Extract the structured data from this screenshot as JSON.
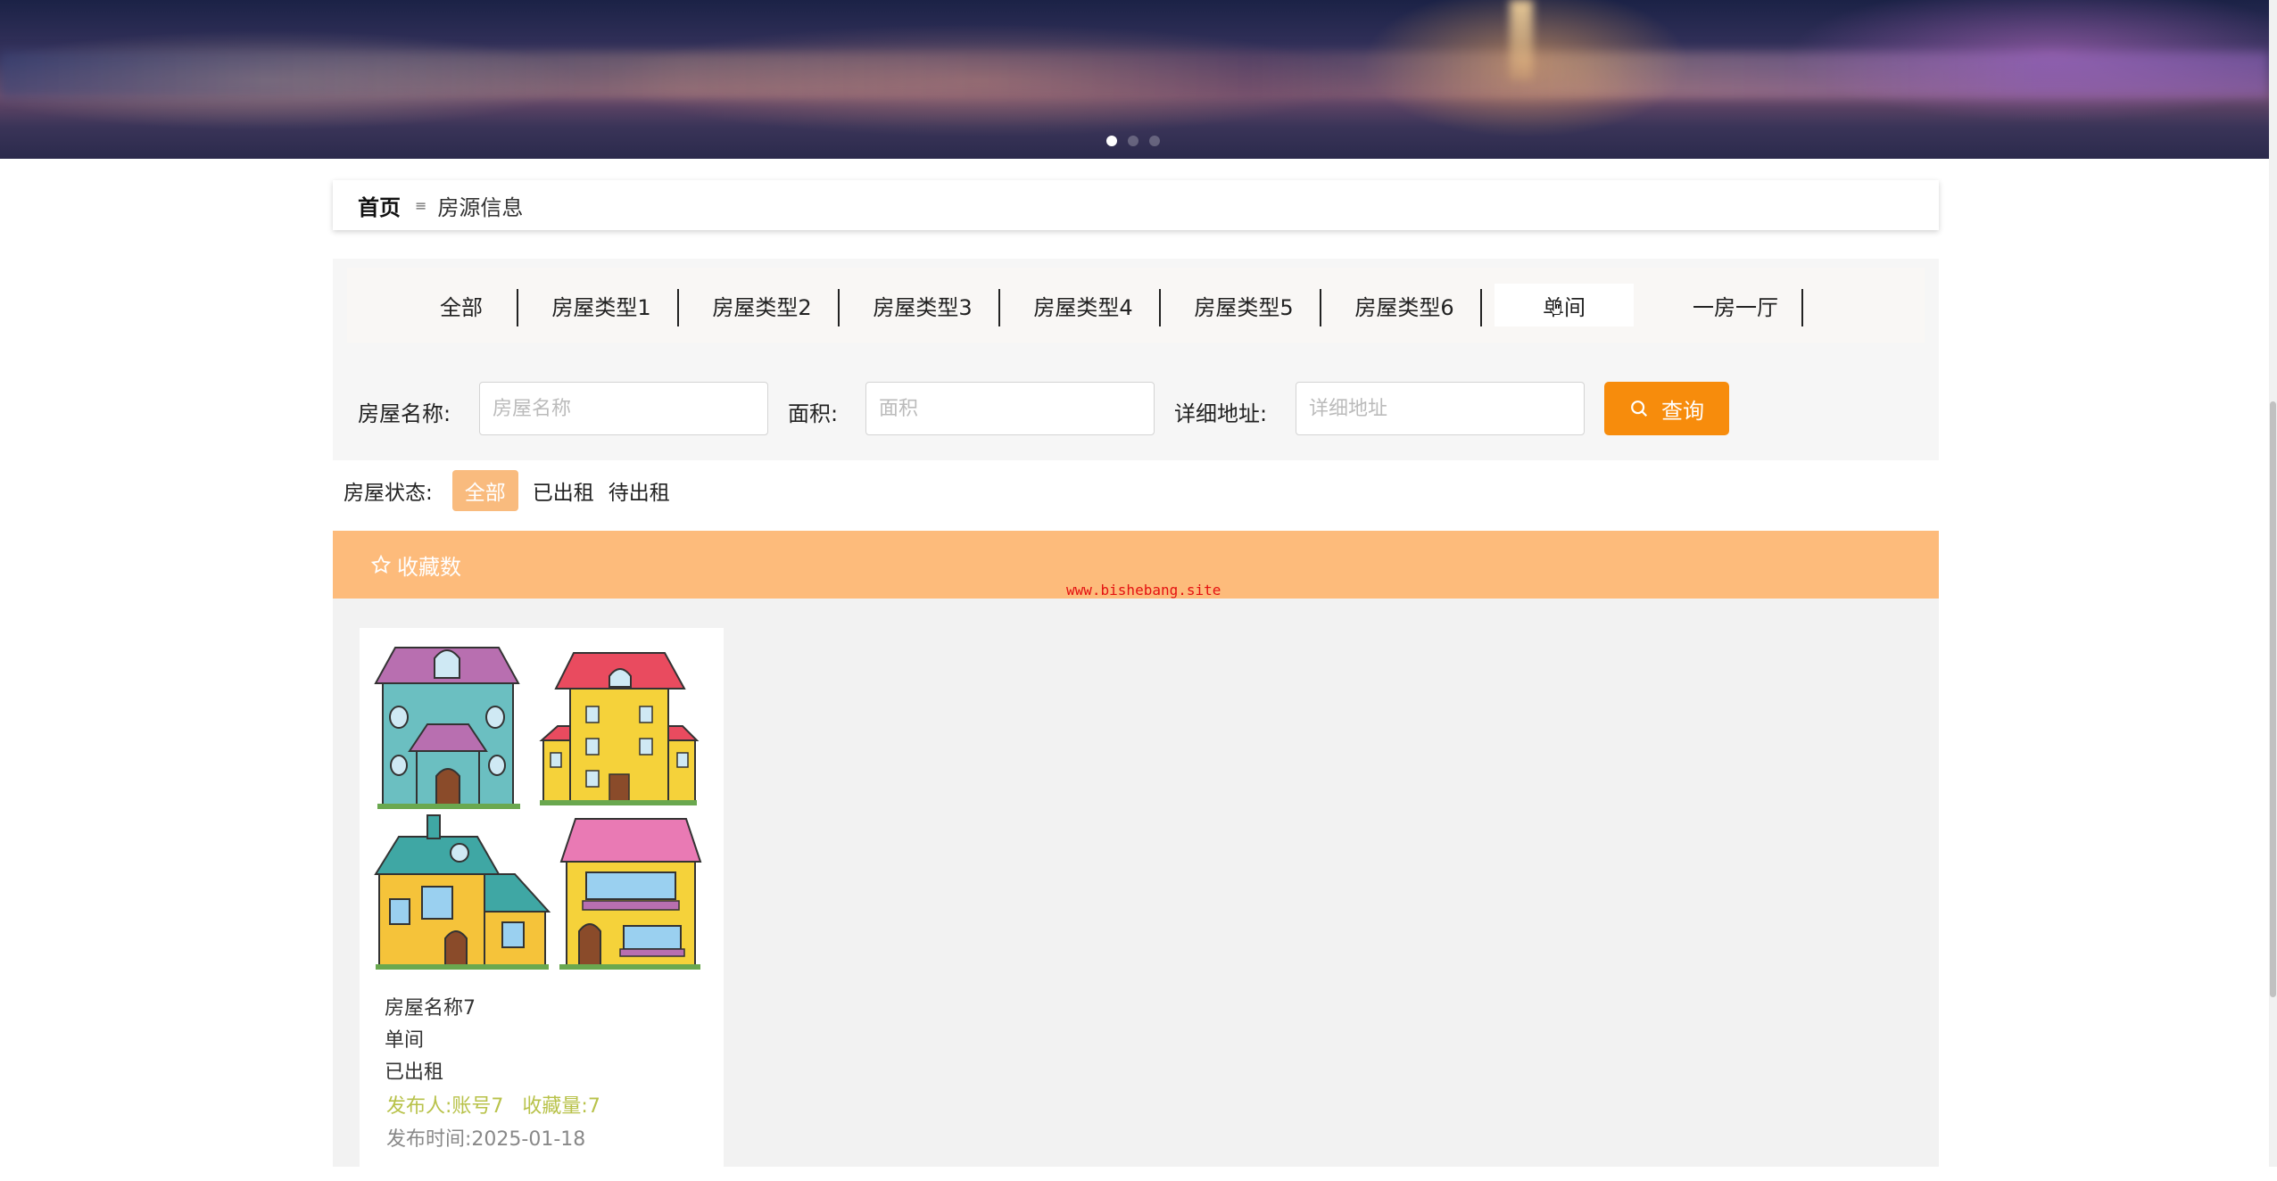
{
  "banner": {
    "dots": 3,
    "active_dot": 0
  },
  "breadcrumb": {
    "home": "首页",
    "separator": "≡",
    "current": "房源信息"
  },
  "tabs": [
    {
      "label": "全部",
      "active": false
    },
    {
      "label": "房屋类型1",
      "active": false
    },
    {
      "label": "房屋类型2",
      "active": false
    },
    {
      "label": "房屋类型3",
      "active": false
    },
    {
      "label": "房屋类型4",
      "active": false
    },
    {
      "label": "房屋类型5",
      "active": false
    },
    {
      "label": "房屋类型6",
      "active": false
    },
    {
      "label": "单间",
      "active": true
    },
    {
      "label": "一房一厅",
      "active": false
    }
  ],
  "search": {
    "name_label": "房屋名称:",
    "name_placeholder": "房屋名称",
    "area_label": "面积:",
    "area_placeholder": "面积",
    "address_label": "详细地址:",
    "address_placeholder": "详细地址",
    "button_label": "查询",
    "button_color": "#f78c0c"
  },
  "status": {
    "label": "房屋状态:",
    "options": [
      "全部",
      "已出租",
      "待出租"
    ],
    "active_index": 0,
    "active_color": "#f9bb7e"
  },
  "sort": {
    "label": "收藏数",
    "bar_color": "#fdbb7b"
  },
  "watermark": "www.bishebang.site",
  "cards": [
    {
      "name": "房屋名称7",
      "type": "单间",
      "status": "已出租",
      "publisher": "发布人:账号7",
      "favorites": "收藏量:7",
      "publish_time": "发布时间:2025-01-18"
    }
  ]
}
